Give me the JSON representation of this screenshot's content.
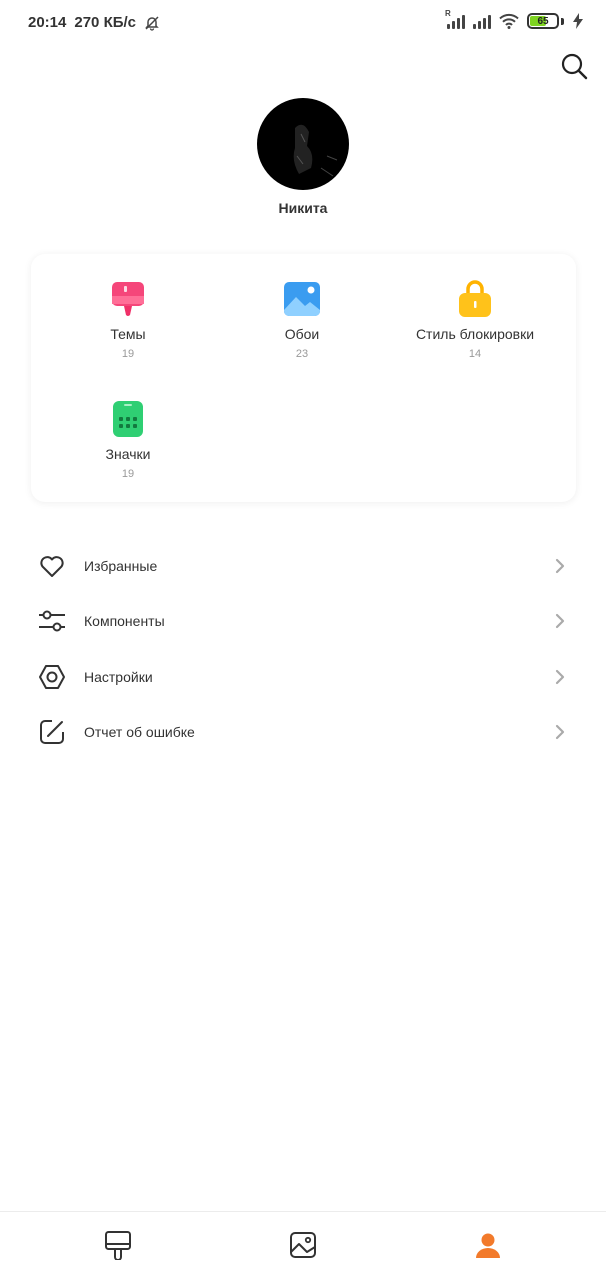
{
  "status_bar": {
    "time": "20:14",
    "speed": "270 КБ/с",
    "battery_level": "65",
    "battery_percent": 65,
    "signal_roaming_label": "R",
    "icons": [
      "muted-bell-icon",
      "signal-icon",
      "wifi-icon",
      "battery-icon",
      "charging-icon"
    ]
  },
  "header": {
    "search_icon": "search-icon"
  },
  "profile": {
    "name": "Никита"
  },
  "categories": [
    {
      "label": "Темы",
      "count": "19",
      "icon": "theme-brush-icon",
      "color": "#f5467a"
    },
    {
      "label": "Обои",
      "count": "23",
      "icon": "wallpaper-icon",
      "color": "#3a9cf0"
    },
    {
      "label": "Стиль блокировки",
      "count": "14",
      "icon": "lock-style-icon",
      "color": "#ffc21a"
    },
    {
      "label": "Значки",
      "count": "19",
      "icon": "icons-grid-icon",
      "color": "#2fcf73"
    }
  ],
  "menu": [
    {
      "label": "Избранные",
      "icon": "heart-icon"
    },
    {
      "label": "Компоненты",
      "icon": "sliders-icon"
    },
    {
      "label": "Настройки",
      "icon": "hexagon-settings-icon"
    },
    {
      "label": "Отчет об ошибке",
      "icon": "edit-square-icon"
    }
  ],
  "bottom_nav": [
    {
      "icon": "themes-tab-icon",
      "active": false
    },
    {
      "icon": "wallpapers-tab-icon",
      "active": false
    },
    {
      "icon": "profile-tab-icon",
      "active": true
    }
  ],
  "colors": {
    "accent": "#f27a2b",
    "text": "#333333",
    "muted": "#999999"
  }
}
